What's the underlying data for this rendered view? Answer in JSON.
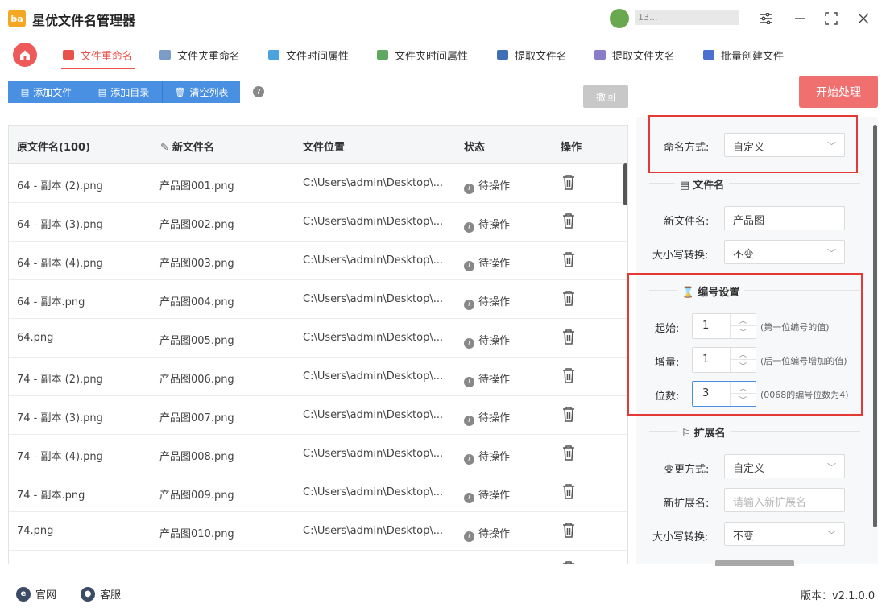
{
  "app": {
    "title": "星优文件名管理器",
    "logo_text": "ba",
    "user_name": "13..."
  },
  "tabs": [
    {
      "label": "文件重命名",
      "active": true,
      "icon_color": "#e9524a"
    },
    {
      "label": "文件夹重命名",
      "active": false,
      "icon_color": "#7a9cc6"
    },
    {
      "label": "文件时间属性",
      "active": false,
      "icon_color": "#4aa3df"
    },
    {
      "label": "文件夹时间属性",
      "active": false,
      "icon_color": "#5fa85f"
    },
    {
      "label": "提取文件名",
      "active": false,
      "icon_color": "#3f6fb5"
    },
    {
      "label": "提取文件夹名",
      "active": false,
      "icon_color": "#8a7cc9"
    },
    {
      "label": "批量创建文件",
      "active": false,
      "icon_color": "#4a6fd1"
    }
  ],
  "toolbar": {
    "add_file": "添加文件",
    "add_dir": "添加目录",
    "clear_list": "清空列表",
    "undo": "撤回",
    "start": "开始处理"
  },
  "table": {
    "headers": {
      "original": "原文件名(100)",
      "new_name": "新文件名",
      "location": "文件位置",
      "status": "状态",
      "action": "操作"
    },
    "rows": [
      {
        "original": "64 - 副本 (2).png",
        "new_name": "产品图001.png",
        "location": "C:\\Users\\admin\\Desktop\\...",
        "status": "待操作"
      },
      {
        "original": "64 - 副本 (3).png",
        "new_name": "产品图002.png",
        "location": "C:\\Users\\admin\\Desktop\\...",
        "status": "待操作"
      },
      {
        "original": "64 - 副本 (4).png",
        "new_name": "产品图003.png",
        "location": "C:\\Users\\admin\\Desktop\\...",
        "status": "待操作"
      },
      {
        "original": "64 - 副本.png",
        "new_name": "产品图004.png",
        "location": "C:\\Users\\admin\\Desktop\\...",
        "status": "待操作"
      },
      {
        "original": "64.png",
        "new_name": "产品图005.png",
        "location": "C:\\Users\\admin\\Desktop\\...",
        "status": "待操作"
      },
      {
        "original": "74 - 副本 (2).png",
        "new_name": "产品图006.png",
        "location": "C:\\Users\\admin\\Desktop\\...",
        "status": "待操作"
      },
      {
        "original": "74 - 副本 (3).png",
        "new_name": "产品图007.png",
        "location": "C:\\Users\\admin\\Desktop\\...",
        "status": "待操作"
      },
      {
        "original": "74 - 副本 (4).png",
        "new_name": "产品图008.png",
        "location": "C:\\Users\\admin\\Desktop\\...",
        "status": "待操作"
      },
      {
        "original": "74 - 副本.png",
        "new_name": "产品图009.png",
        "location": "C:\\Users\\admin\\Desktop\\...",
        "status": "待操作"
      },
      {
        "original": "74.png",
        "new_name": "产品图010.png",
        "location": "C:\\Users\\admin\\Desktop\\...",
        "status": "待操作"
      }
    ]
  },
  "settings": {
    "naming_label": "命名方式:",
    "naming_value": "自定义",
    "filename_section": "文件名",
    "new_name_label": "新文件名:",
    "new_name_value": "产品图",
    "case_label": "大小写转换:",
    "case_value": "不变",
    "numbering_section": "编号设置",
    "start_label": "起始:",
    "start_value": "1",
    "start_hint": "(第一位编号的值)",
    "step_label": "增量:",
    "step_value": "1",
    "step_hint": "(后一位编号增加的值)",
    "digits_label": "位数:",
    "digits_value": "3",
    "digits_hint": "(0068的编号位数为4)",
    "ext_section": "扩展名",
    "change_label": "变更方式:",
    "change_value": "自定义",
    "new_ext_label": "新扩展名:",
    "new_ext_placeholder": "请输入新扩展名",
    "ext_case_label": "大小写转换:",
    "ext_case_value": "不变"
  },
  "footer": {
    "website": "官网",
    "support": "客服",
    "version": "版本：v2.1.0.0"
  },
  "colors": {
    "accent": "#e9524a",
    "primary": "#4a90e2",
    "start_button": "#f07070",
    "highlight_box": "#e53935"
  }
}
